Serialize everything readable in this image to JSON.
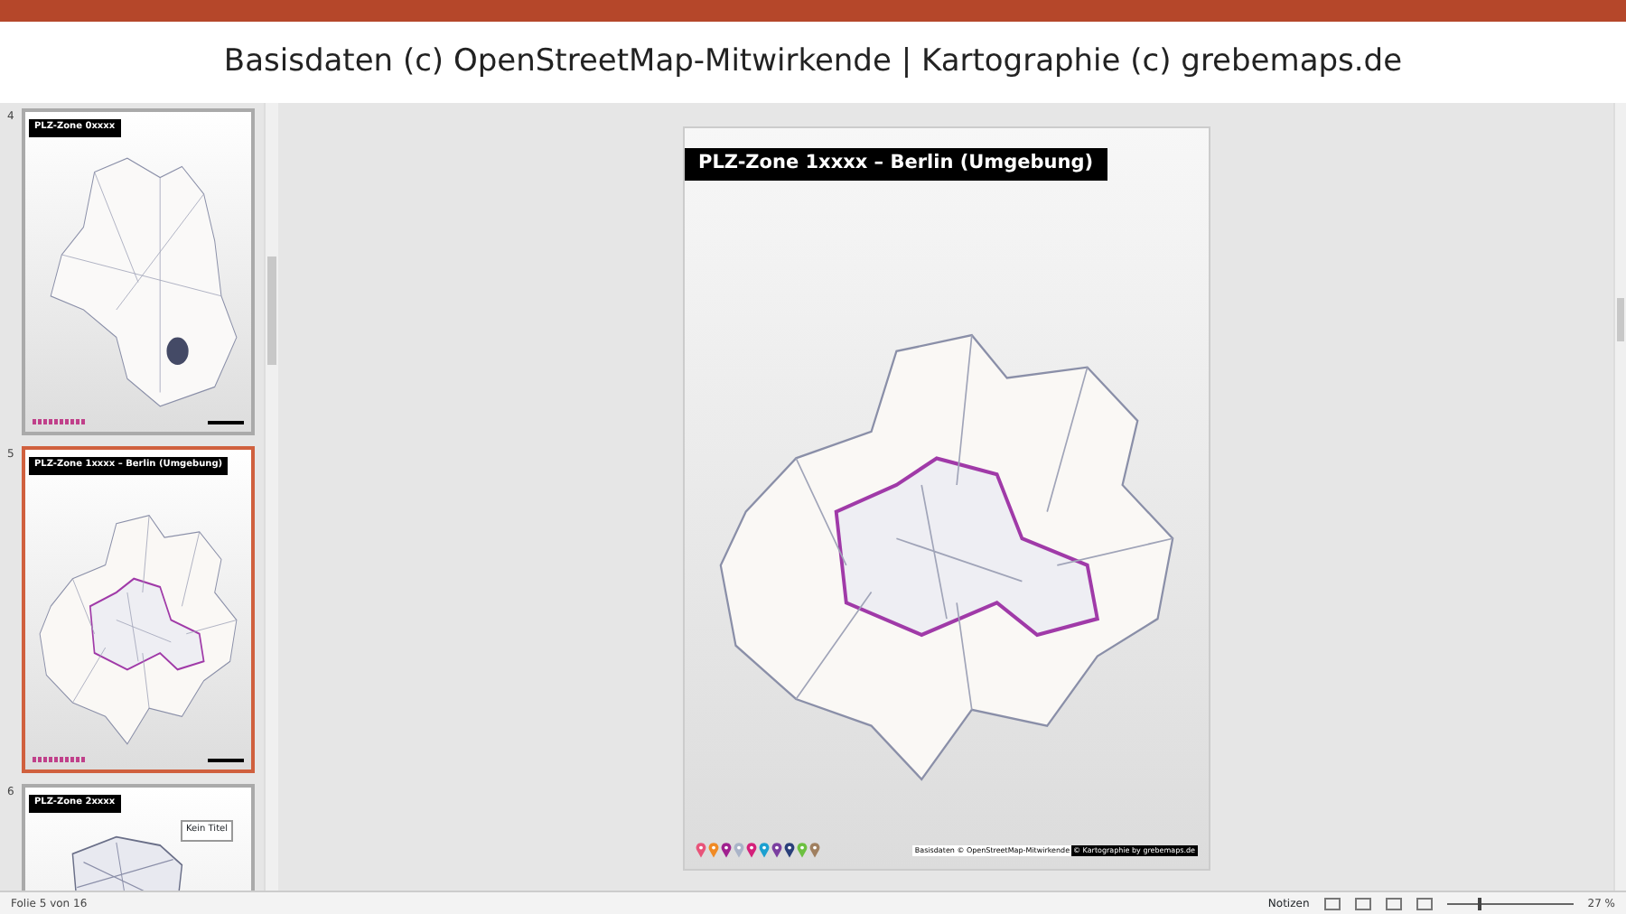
{
  "header": {
    "caption": "Basisdaten (c) OpenStreetMap-Mitwirkende | Kartographie (c) grebemaps.de"
  },
  "slides": [
    {
      "number": "4",
      "title": "PLZ-Zone 0xxxx",
      "selected": false,
      "kind": "region"
    },
    {
      "number": "5",
      "title": "PLZ-Zone 1xxxx – Berlin (Umgebung)",
      "selected": true,
      "kind": "berlin"
    },
    {
      "number": "6",
      "title": "PLZ-Zone 2xxxx",
      "selected": false,
      "kind": "partial",
      "text_box": "Kein Titel"
    }
  ],
  "main_slide": {
    "title": "PLZ-Zone 1xxxx – Berlin (Umgebung)",
    "pins": [
      {
        "color": "#e8547a"
      },
      {
        "color": "#f08a24"
      },
      {
        "color": "#a0208f"
      },
      {
        "color": "#aab4c8"
      },
      {
        "color": "#d4207a"
      },
      {
        "color": "#1ca0d0"
      },
      {
        "color": "#7b3fa0"
      },
      {
        "color": "#2a3f7a"
      },
      {
        "color": "#6cc040"
      },
      {
        "color": "#a08060"
      }
    ],
    "attribution": "Basisdaten © OpenStreetMap-Mitwirkende",
    "credit": "© Kartographie by grebemaps.de"
  },
  "status_bar": {
    "slide_info": "Folie 5 von 16",
    "notes": "Notizen",
    "zoom": "27 %",
    "zoom_slider": {
      "level": 0.25
    }
  }
}
